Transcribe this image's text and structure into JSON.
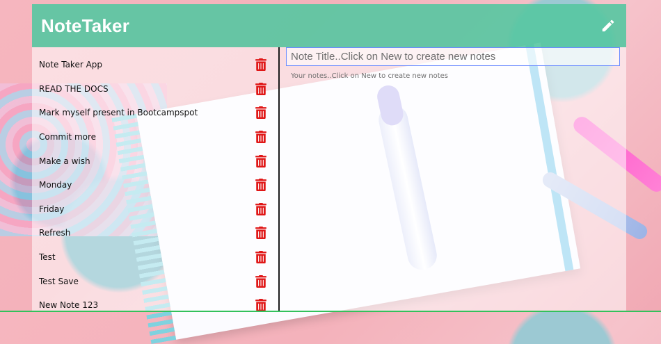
{
  "app": {
    "title": "NoteTaker",
    "actions": {
      "new_icon": "pencil-icon"
    }
  },
  "notes_list": {
    "items": [
      {
        "label": "Note Taker App",
        "delete_icon": "trash-icon"
      },
      {
        "label": "READ THE DOCS",
        "delete_icon": "trash-icon"
      },
      {
        "label": "Mark myself present in Bootcampspot",
        "delete_icon": "trash-icon"
      },
      {
        "label": "Commit more",
        "delete_icon": "trash-icon"
      },
      {
        "label": "Make a wish",
        "delete_icon": "trash-icon"
      },
      {
        "label": "Monday",
        "delete_icon": "trash-icon"
      },
      {
        "label": "Friday",
        "delete_icon": "trash-icon"
      },
      {
        "label": "Refresh",
        "delete_icon": "trash-icon"
      },
      {
        "label": "Test",
        "delete_icon": "trash-icon"
      },
      {
        "label": "Test Save",
        "delete_icon": "trash-icon"
      },
      {
        "label": "New Note 123",
        "delete_icon": "trash-icon"
      }
    ]
  },
  "editor": {
    "title_placeholder": "Note Title..Click on New to create new notes",
    "title_value": "",
    "notes_placeholder": "Your notes..Click on New to create new notes",
    "notes_value": ""
  },
  "colors": {
    "header": "#56c6a1",
    "trash": "#e01717",
    "focus_border": "#6b8cff",
    "divider": "#1b1b1b",
    "bottom_line": "#33c15b"
  }
}
